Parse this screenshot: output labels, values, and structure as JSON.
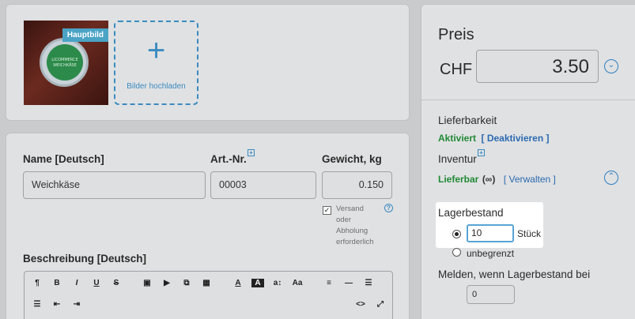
{
  "images": {
    "badge": "Hauptbild",
    "tin_text": "LICOMMERCE WEICHKÄSE",
    "upload_label": "Bilder hochladen"
  },
  "product": {
    "name_label": "Name [Deutsch]",
    "name_value": "Weichkäse",
    "sku_label": "Art.-Nr.",
    "sku_value": "00003",
    "weight_label": "Gewicht, kg",
    "weight_value": "0.150",
    "shipping_lines": [
      "Versand",
      "oder",
      "Abholung",
      "erforderlich"
    ],
    "description_label": "Beschreibung [Deutsch]"
  },
  "editor_toolbar": {
    "row1": [
      "¶",
      "B",
      "I",
      "U",
      "S",
      "▣",
      "▶",
      "⧉",
      "▦",
      "A",
      "A",
      "a↕",
      "Aa",
      "≡",
      "—",
      "☰"
    ],
    "row2": [
      "☰",
      "⇤",
      "⇥",
      "<>",
      "⤢"
    ]
  },
  "price": {
    "title": "Preis",
    "currency": "CHF",
    "value": "3.50"
  },
  "availability": {
    "label": "Lieferbarkeit",
    "status": "Aktiviert",
    "action": "[ Deaktivieren ]"
  },
  "inventory": {
    "label": "Inventur",
    "status": "Lieferbar",
    "status_suffix": "(∞)",
    "action": "[ Verwalten ]",
    "stock_label": "Lagerbestand",
    "stock_value": "10",
    "unit": "Stück",
    "unlimited_label": "unbegrenzt",
    "notify_label": "Melden, wenn Lagerbestand bei",
    "notify_value": "0"
  }
}
